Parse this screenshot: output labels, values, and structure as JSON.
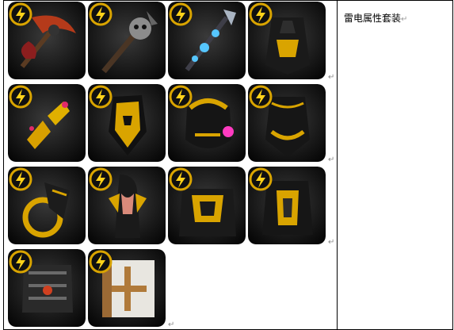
{
  "cell_right_text": "雷电属性套装",
  "paragraph_mark": "↵",
  "icons": [
    {
      "name": "scythe-weapon-icon",
      "row": 1,
      "col": 1
    },
    {
      "name": "skull-staff-icon",
      "row": 1,
      "col": 2
    },
    {
      "name": "crystal-spear-icon",
      "row": 1,
      "col": 3
    },
    {
      "name": "black-armor-icon",
      "row": 1,
      "col": 4
    },
    {
      "name": "gold-claw-gloves-icon",
      "row": 2,
      "col": 1
    },
    {
      "name": "gold-mask-helmet-icon",
      "row": 2,
      "col": 2
    },
    {
      "name": "gold-gem-helmet-icon",
      "row": 2,
      "col": 3
    },
    {
      "name": "black-gold-helmet-icon",
      "row": 2,
      "col": 4
    },
    {
      "name": "gold-ring-gauntlet-icon",
      "row": 3,
      "col": 1
    },
    {
      "name": "female-armor-icon",
      "row": 3,
      "col": 2
    },
    {
      "name": "heavy-armor-icon",
      "row": 3,
      "col": 3
    },
    {
      "name": "chest-armor-icon",
      "row": 3,
      "col": 4
    },
    {
      "name": "dark-shield-icon",
      "row": 4,
      "col": 1
    },
    {
      "name": "white-cross-shield-icon",
      "row": 4,
      "col": 2
    }
  ],
  "badge_symbol": "⚡"
}
